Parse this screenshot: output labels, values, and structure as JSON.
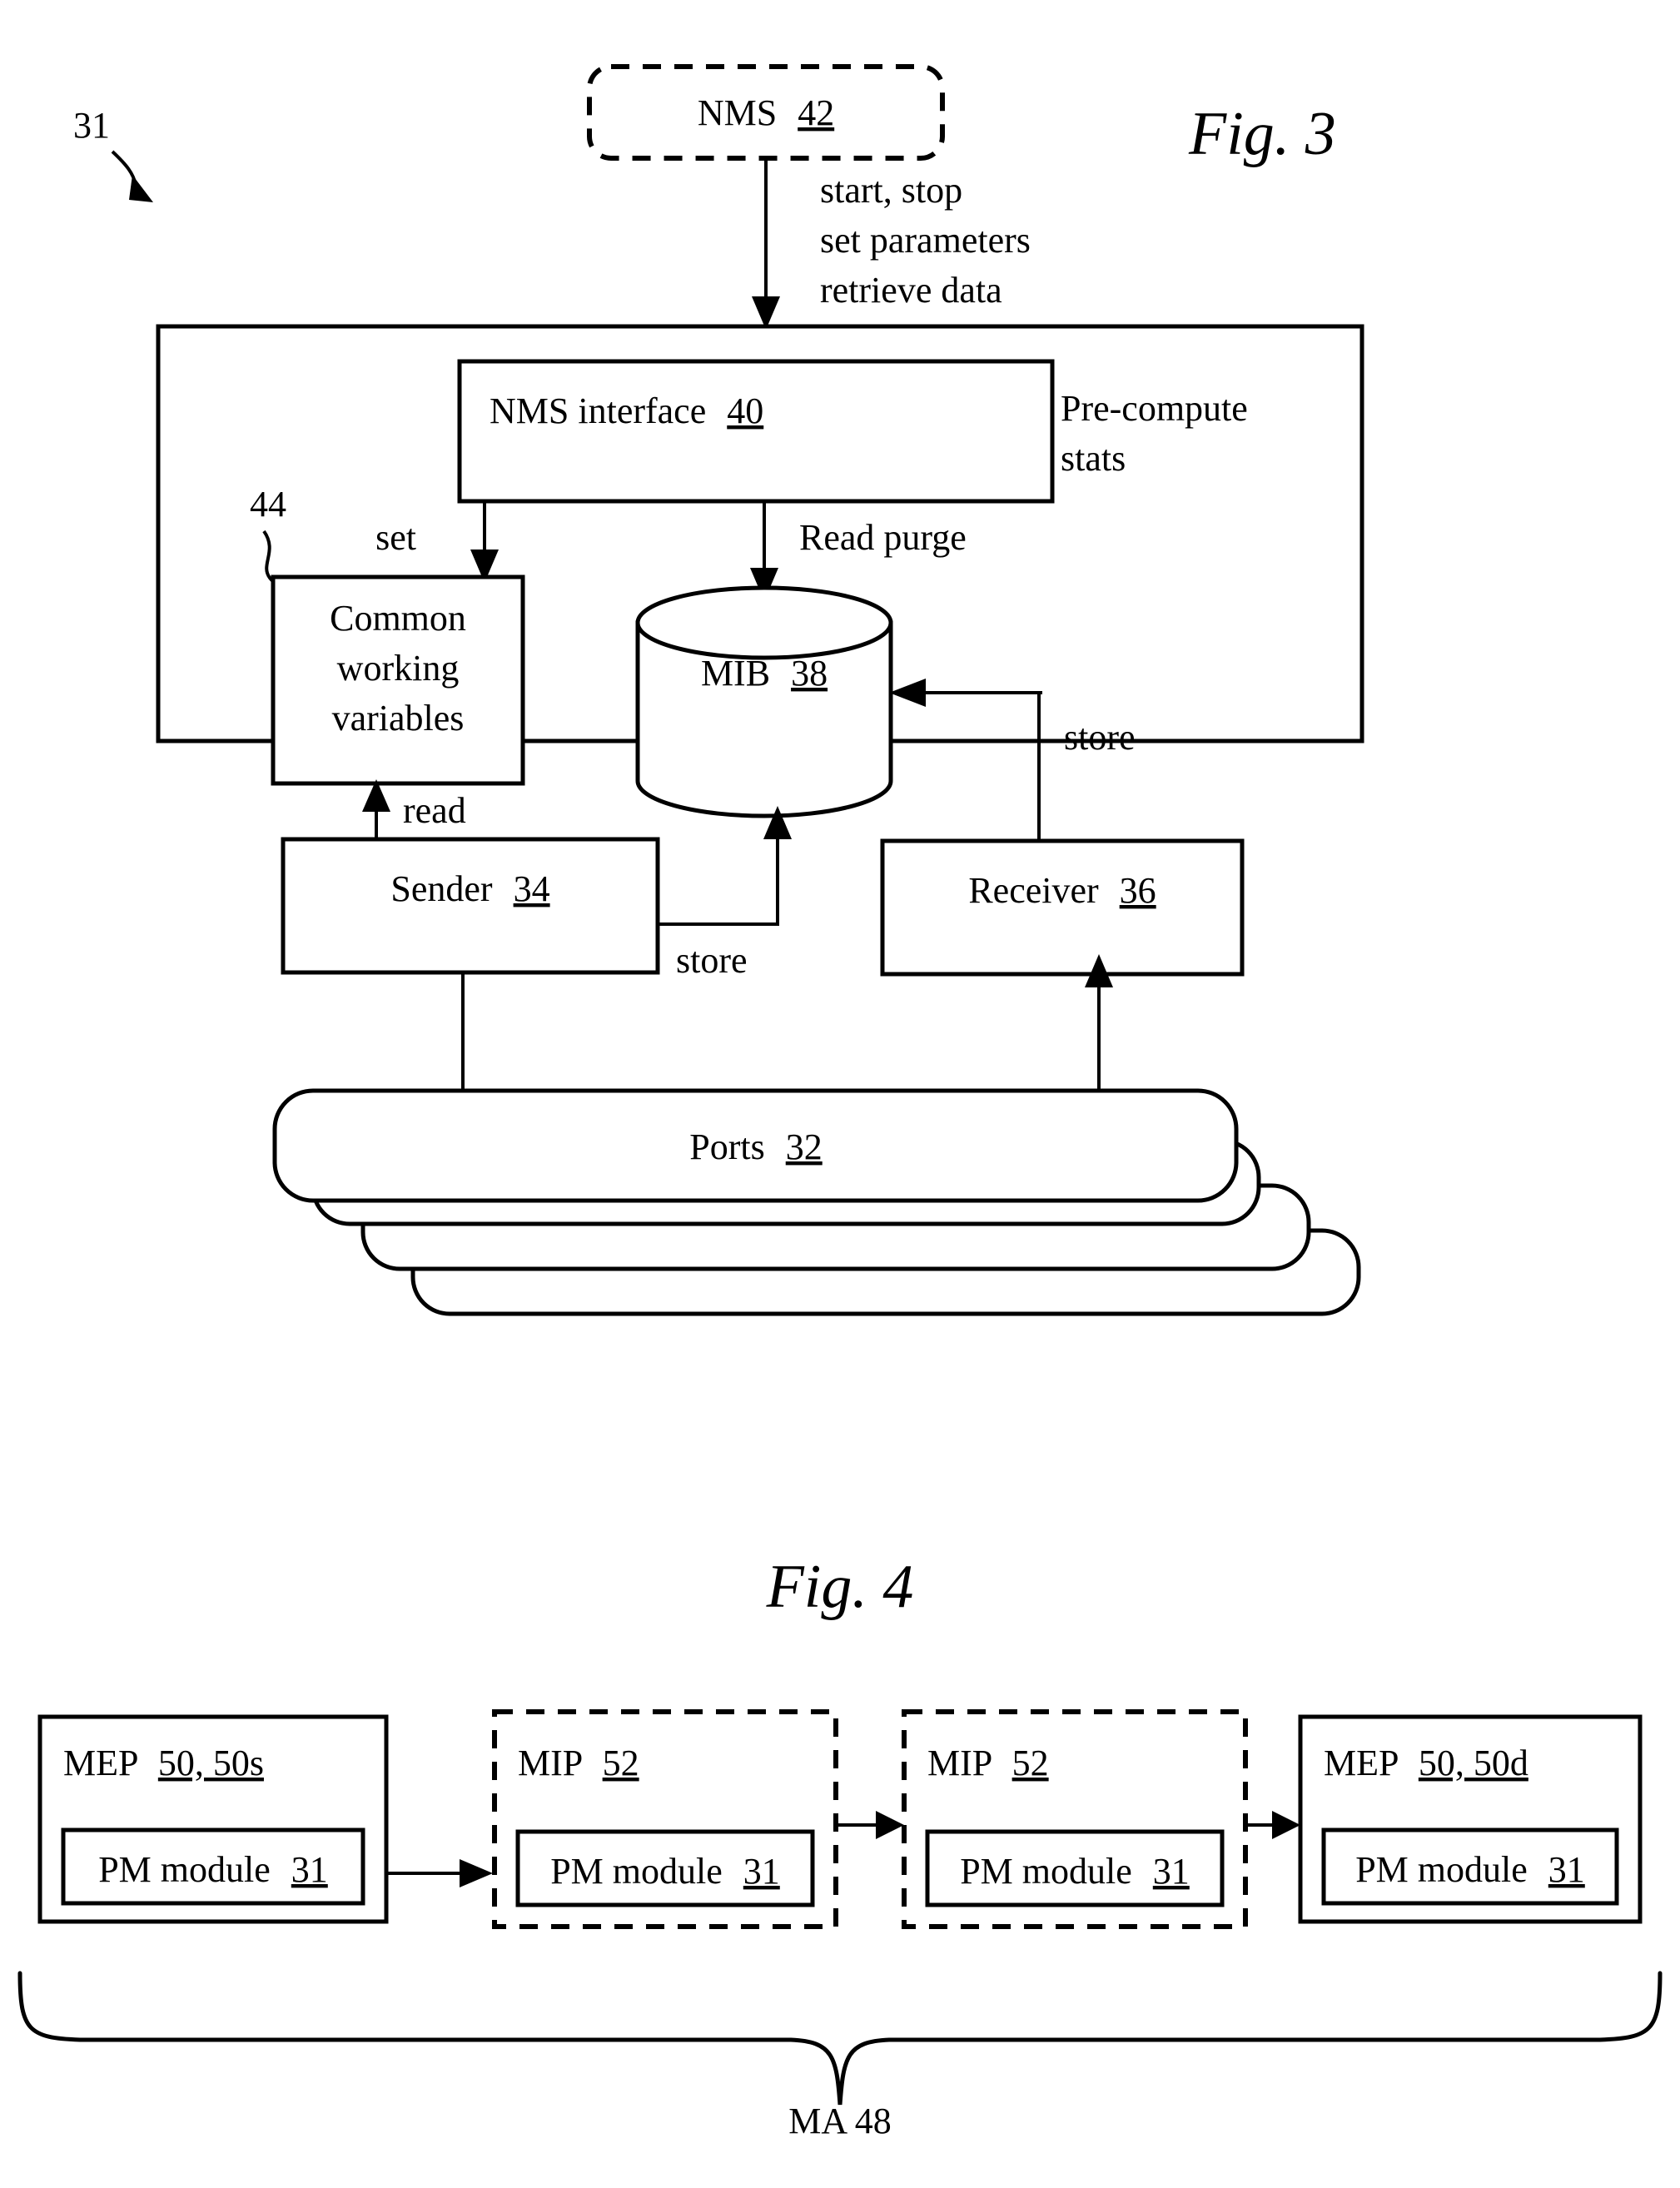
{
  "figures": [
    {
      "id": "fig3",
      "caption": "Fig. 3",
      "ref_number": "31",
      "callout_44": "44",
      "nodes": {
        "nms": "NMS 42",
        "nms_label": "NMS",
        "nms_num": "42",
        "nms_interface": "NMS interface 40",
        "nms_interface_label": "NMS interface",
        "nms_interface_num": "40",
        "common_vars_line1": "Common",
        "common_vars_line2": "working",
        "common_vars_line3": "variables",
        "mib_label": "MIB",
        "mib_num": "38",
        "sender_label": "Sender",
        "sender_num": "34",
        "receiver_label": "Receiver",
        "receiver_num": "36",
        "ports_label": "Ports",
        "ports_num": "32"
      },
      "edge_labels": {
        "nms_down_line1": "start, stop",
        "nms_down_line2": "set parameters",
        "nms_down_line3": "retrieve data",
        "pre_compute_line1": "Pre-compute",
        "pre_compute_line2": "stats",
        "set": "set",
        "read_purge": "Read purge",
        "store_receiver": "store",
        "read": "read",
        "store_sender": "store"
      }
    },
    {
      "id": "fig4",
      "caption": "Fig. 4",
      "blocks": [
        {
          "title_label": "MEP",
          "title_num": "50, 50s",
          "style": "solid",
          "inner_label": "PM module",
          "inner_num": "31"
        },
        {
          "title_label": "MIP",
          "title_num": "52",
          "style": "dashed",
          "inner_label": "PM module",
          "inner_num": "31"
        },
        {
          "title_label": "MIP",
          "title_num": "52",
          "style": "dashed",
          "inner_label": "PM module",
          "inner_num": "31"
        },
        {
          "title_label": "MEP",
          "title_num": "50, 50d",
          "style": "solid",
          "inner_label": "PM module",
          "inner_num": "31"
        }
      ],
      "brace_label": "MA 48"
    }
  ],
  "colors": {
    "ink": "#000000",
    "paper": "#ffffff"
  }
}
